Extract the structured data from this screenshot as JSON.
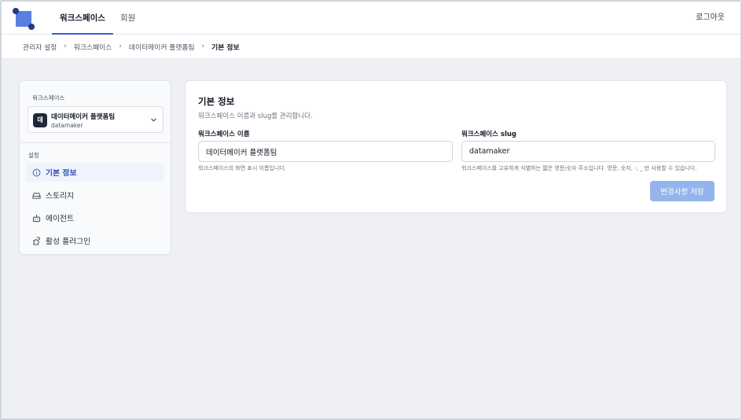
{
  "nav": {
    "tabs": [
      {
        "label": "워크스페이스",
        "active": true
      },
      {
        "label": "회원",
        "active": false
      }
    ],
    "logout_label": "로그아웃"
  },
  "breadcrumb": [
    "관리자 설정",
    "워크스페이스",
    "데이터메이커 플랫폼팀",
    "기본 정보"
  ],
  "sidebar": {
    "workspace_label": "워크스페이스",
    "workspace": {
      "avatar": "데",
      "name": "데이터메이커 플랫폼팀",
      "slug": "datamaker"
    },
    "section_label": "설정",
    "items": [
      {
        "label": "기본 정보",
        "icon": "info-icon",
        "active": true
      },
      {
        "label": "스토리지",
        "icon": "storage-icon",
        "active": false
      },
      {
        "label": "에이전트",
        "icon": "robot-icon",
        "active": false
      },
      {
        "label": "활성 플러그인",
        "icon": "puzzle-icon",
        "active": false
      }
    ]
  },
  "main": {
    "title": "기본 정보",
    "description": "워크스페이스 이름과 slug를 관리합니다.",
    "name_field": {
      "label": "워크스페이스 이름",
      "value": "데이터메이커 플랫폼팀",
      "help": "워크스페이스의 화면 표시 이름입니다."
    },
    "slug_field": {
      "label": "워크스페이스 slug",
      "value": "datamaker",
      "help": "워크스페이스를 고유하게 식별하는 짧은 영문/숫자 주소입니다. 영문, 숫자, -, _ 만 사용할 수 있습니다."
    },
    "save_label": "변경사항 저장"
  },
  "colors": {
    "accent": "#3b5bdb",
    "save_disabled": "#93b4ec",
    "logo": "#5b7fe0"
  }
}
